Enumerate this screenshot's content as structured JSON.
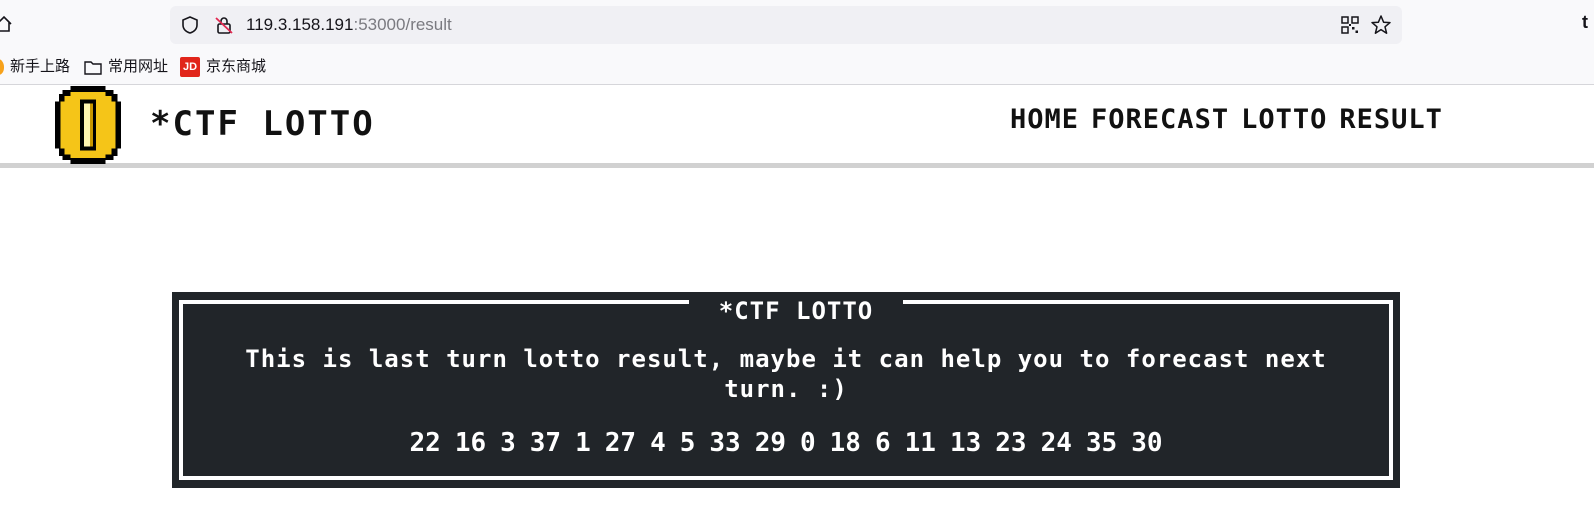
{
  "browser": {
    "url_host": "119.3.158.191",
    "url_rest": ":53000/result",
    "edge_glyph": "t",
    "bookmarks": [
      "新手上路",
      "常用网址",
      "京东商城"
    ],
    "jd_badge": "JD"
  },
  "site": {
    "brand": "*CTF LOTTO",
    "nav": [
      "HOME",
      "FORECAST",
      "LOTTO",
      "RESULT"
    ]
  },
  "result_box": {
    "title": "*CTF LOTTO",
    "message": "This is last turn lotto result, maybe it can help you to forecast next turn. :)",
    "numbers": [
      "22",
      "16",
      "3",
      "37",
      "1",
      "27",
      "4",
      "5",
      "33",
      "29",
      "0",
      "18",
      "6",
      "11",
      "13",
      "23",
      "24",
      "35",
      "30"
    ]
  },
  "colors": {
    "box_bg": "#212529",
    "coin_gold": "#f5c518",
    "jd_red": "#e1251b"
  }
}
